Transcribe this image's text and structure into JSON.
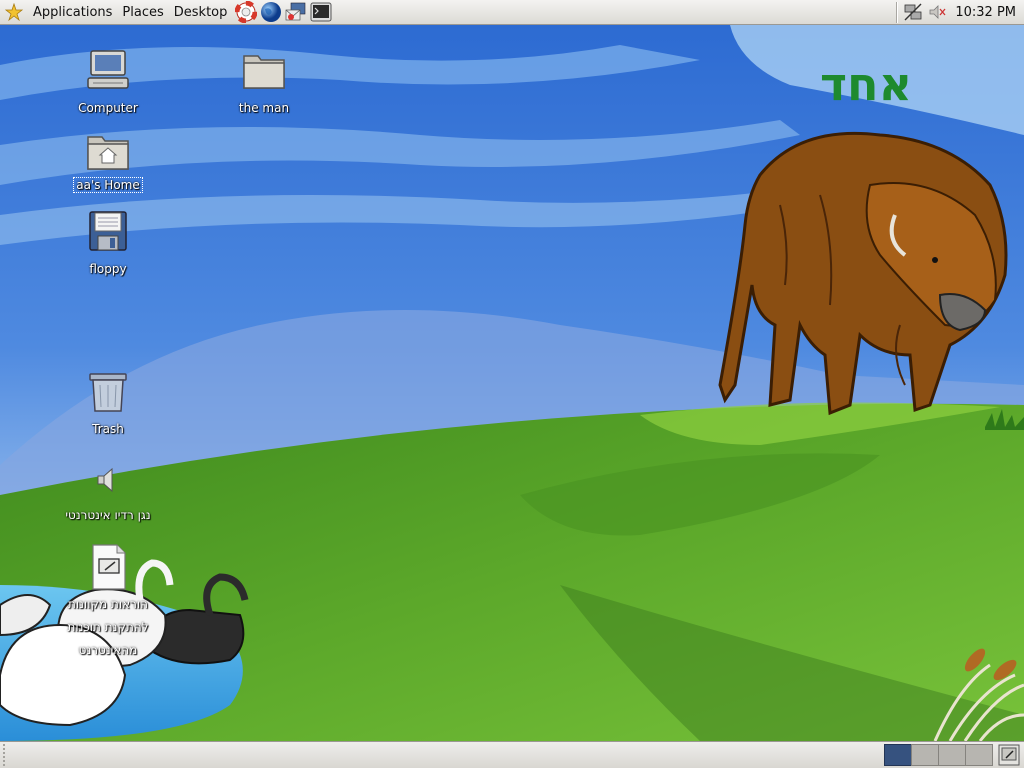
{
  "top_panel": {
    "menus": [
      {
        "label": "Applications"
      },
      {
        "label": "Places"
      },
      {
        "label": "Desktop"
      }
    ],
    "launchers": [
      "help-lifebuoy-icon",
      "web-browser-globe-icon",
      "email-client-icon",
      "terminal-icon"
    ],
    "tray": [
      "network-icon",
      "volume-muted-icon"
    ],
    "clock": "10:32 PM"
  },
  "wallpaper": {
    "logo_text": "אחד",
    "colors": {
      "sky": "#2f6fd0",
      "grass": "#5ca82a",
      "water": "#5ab4e8",
      "bison": "#8a4e12"
    }
  },
  "desktop_icons": [
    {
      "label": "Computer",
      "icon": "computer-icon"
    },
    {
      "label": "the man",
      "icon": "folder-icon"
    },
    {
      "label": "aa's Home",
      "icon": "home-folder-icon",
      "selected": true
    },
    {
      "label": "floppy",
      "icon": "floppy-icon"
    },
    {
      "label": "Trash",
      "icon": "trash-icon"
    },
    {
      "label": "נגן רדיו אינטרנטי",
      "icon": "speaker-icon"
    },
    {
      "label": "הוראות מקוונות להתקנת תוכנות מהאינטרנט",
      "icon": "text-document-icon"
    }
  ],
  "bottom_panel": {
    "workspaces": [
      {
        "active": true
      },
      {
        "active": false
      },
      {
        "active": false
      },
      {
        "active": false
      }
    ],
    "trash_applet": "trash-applet-icon"
  }
}
